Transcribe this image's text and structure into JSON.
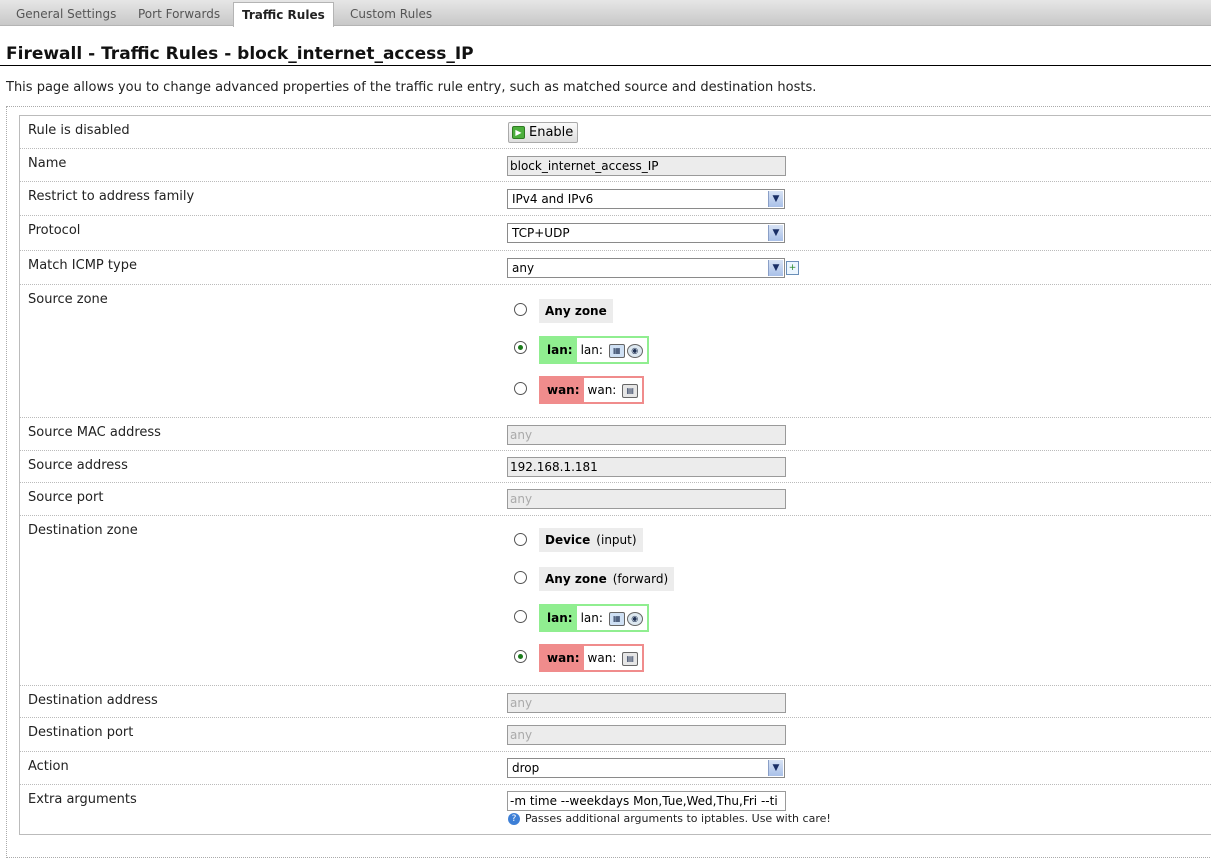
{
  "tabs": [
    {
      "label": "General Settings"
    },
    {
      "label": "Port Forwards"
    },
    {
      "label": "Traffic Rules"
    },
    {
      "label": "Custom Rules"
    }
  ],
  "page": {
    "title": "Firewall - Traffic Rules - block_internet_access_IP",
    "description": "This page allows you to change advanced properties of the traffic rule entry, such as matched source and destination hosts."
  },
  "form": {
    "rule_disabled": {
      "label": "Rule is disabled",
      "button": "Enable"
    },
    "name": {
      "label": "Name",
      "value": "block_internet_access_IP"
    },
    "address_family": {
      "label": "Restrict to address family",
      "value": "IPv4 and IPv6"
    },
    "protocol": {
      "label": "Protocol",
      "value": "TCP+UDP"
    },
    "icmp_type": {
      "label": "Match ICMP type",
      "value": "any"
    },
    "source_zone": {
      "label": "Source zone",
      "any": "Any zone",
      "lan": {
        "name": "lan:",
        "iface": "lan:"
      },
      "wan": {
        "name": "wan:",
        "iface": "wan:"
      },
      "selected": "lan"
    },
    "source_mac": {
      "label": "Source MAC address",
      "placeholder": "any"
    },
    "source_address": {
      "label": "Source address",
      "value": "192.168.1.181"
    },
    "source_port": {
      "label": "Source port",
      "placeholder": "any"
    },
    "dest_zone": {
      "label": "Destination zone",
      "device": "Device",
      "device_sub": "(input)",
      "any": "Any zone",
      "any_sub": "(forward)",
      "lan": {
        "name": "lan:",
        "iface": "lan:"
      },
      "wan": {
        "name": "wan:",
        "iface": "wan:"
      },
      "selected": "wan"
    },
    "dest_address": {
      "label": "Destination address",
      "placeholder": "any"
    },
    "dest_port": {
      "label": "Destination port",
      "placeholder": "any"
    },
    "action": {
      "label": "Action",
      "value": "drop"
    },
    "extra_args": {
      "label": "Extra arguments",
      "value": "-m time --weekdays Mon,Tue,Wed,Thu,Fri --ti",
      "help": "Passes additional arguments to iptables. Use with care!"
    }
  },
  "icons": {
    "select_arrow": "chevron-down-icon",
    "enable": "enable-icon",
    "add": "add-icon",
    "help": "help-icon",
    "network": "network-icon",
    "wireless": "wireless-icon",
    "ethernet": "ethernet-icon"
  },
  "colors": {
    "lan_zone": "#90ee90",
    "wan_zone": "#f08c8c"
  }
}
